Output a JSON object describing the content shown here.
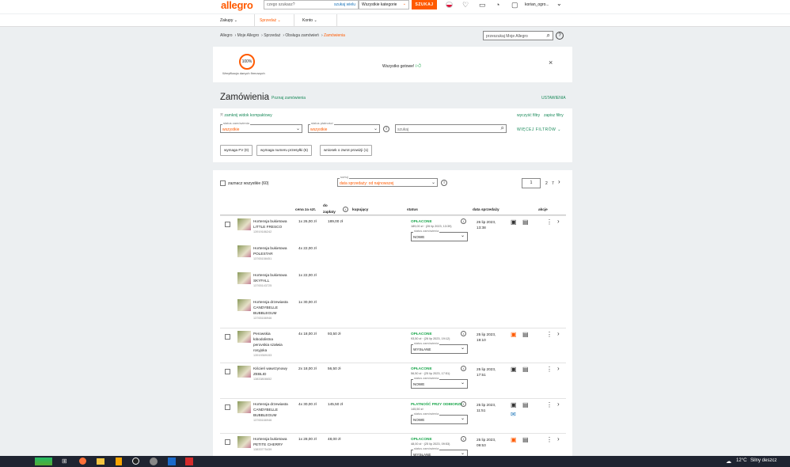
{
  "header": {
    "logo": "allegro",
    "search_placeholder": "czego szukasz?",
    "search_many": "szukaj wielu",
    "category": "Wszystkie kategorie",
    "search_button": "SZUKAJ",
    "user": "korian_ogro..."
  },
  "nav": {
    "buy": "Zakupy",
    "sell": "Sprzedaż",
    "account": "Konto"
  },
  "breadcrumb": [
    "Allegro",
    "Moje Allegro",
    "Sprzedaż",
    "Obsługa zamówień",
    "Zamówienia"
  ],
  "side_search_placeholder": "przeszukaj Moje Allegro",
  "verify": {
    "percent": "100%",
    "label": "Weryfikacja danych firmowych",
    "ready": "Wszystko gotowe!"
  },
  "page": {
    "title": "Zamówienia",
    "learn": "Poznaj zamówienia",
    "settings": "USTAWIENIA"
  },
  "filters": {
    "compact": "zamknij widok kompaktowy",
    "clear": "wyczyść filtry",
    "save": "zapisz filtry",
    "status_order_label": "status zamówienia",
    "status_order_value": "wszystkie",
    "status_pay_label": "status płatności",
    "status_pay_value": "wszystkie",
    "search_placeholder": "szukaj",
    "more": "WIĘCEJ FILTRÓW",
    "chip1": "wymaga FV (0)",
    "chip2": "wymaga numeru przesyłki (6)",
    "chip3": "wniosek o zwrot prowizji (1)"
  },
  "list": {
    "select_all": "zaznacz wszystkie (60)",
    "sort_label": "sortuj",
    "sort_value": "data sprzedaży: od najnowszej",
    "page": "1",
    "page2": "2",
    "page_last": "7"
  },
  "columns": {
    "price": "cena za szt.",
    "pay1": "do",
    "pay2": "zapłaty",
    "buyer": "kupujący",
    "status": "status",
    "date": "data sprzedaży",
    "actions": "akcje"
  },
  "orders": [
    {
      "total": "189,00 zł",
      "paid": "OPŁACONE",
      "pay_info": "189,00 zł · (26 lip 2023, 13:39)",
      "status_label": "status zamówienia",
      "status": "NOWE",
      "date1": "26 lip 2023,",
      "date2": "13:38",
      "items": [
        {
          "name1": "Hortensja bukietowa",
          "name2": "LITTLE FRESCO",
          "id": "13919186242",
          "qty": "1x 26,00 zł"
        },
        {
          "name1": "Hortensja bukietowa",
          "name2": "POLESTAR",
          "id": "13765158451",
          "qty": "4x 22,00 zł"
        },
        {
          "name1": "Hortensja bukietowa",
          "name2": "SKYFALL",
          "id": "13765143725",
          "qty": "1x 22,00 zł"
        },
        {
          "name1": "Hortensja drzewiasta",
          "name2": "CANDYBELLE",
          "name3": "BUBBLEGUM",
          "id": "13765166946",
          "qty": "1x 30,00 zł"
        }
      ]
    },
    {
      "total": "93,50 zł",
      "paid": "OPŁACONE",
      "pay_info": "93,50 zł · (26 lip 2023, 19:12)",
      "status_label": "status zamówienia",
      "status": "WYSŁANE",
      "date1": "25 lip 2023,",
      "date2": "19:10",
      "items": [
        {
          "name1": "Perowskia",
          "name2": "łobodolistna",
          "name3": "perovskia szałwia",
          "name4": "rosyjska",
          "id": "13919369153",
          "qty": "4x 18,00 zł"
        }
      ]
    },
    {
      "total": "56,50 zł",
      "paid": "OPŁACONE",
      "pay_info": "56,50 zł · (25 lip 2023, 17:51)",
      "status_label": "status zamówienia",
      "status": "NOWE",
      "date1": "25 lip 2023,",
      "date2": "17:51",
      "items": [
        {
          "name1": "Kiścień wawrzynowy",
          "name2": "ZEBLID",
          "id": "13833808652",
          "qty": "2x 18,00 zł"
        }
      ]
    },
    {
      "total": "145,50 zł",
      "paid": "PŁATNOŚĆ PRZY ODBIORZE",
      "pay_info": "145,50 zł",
      "status_label": "status zamówienia",
      "status": "NOWE",
      "date1": "25 lip 2023,",
      "date2": "11:51",
      "items": [
        {
          "name1": "Hortensja drzewiasta",
          "name2": "CANDYBELLE",
          "name3": "BUBBLEGUM",
          "id": "13765166946",
          "qty": "4x 30,00 zł"
        }
      ]
    },
    {
      "total": "48,00 zł",
      "paid": "OPŁACONE",
      "pay_info": "48,00 zł · (25 lip 2023, 09:53)",
      "status_label": "status zamówienia",
      "status": "WYSŁANE",
      "date1": "25 lip 2023,",
      "date2": "09:53",
      "items": [
        {
          "name1": "Hortensja bukietowa",
          "name2": "PETITE CHERRY",
          "id": "13833775439",
          "qty": "1x 28,00 zł"
        }
      ]
    }
  ],
  "taskbar": {
    "temp": "12°C",
    "weather": "Silny deszcz"
  },
  "colors": {
    "accent": "#ff5a00",
    "paid": "#1aa64b"
  }
}
